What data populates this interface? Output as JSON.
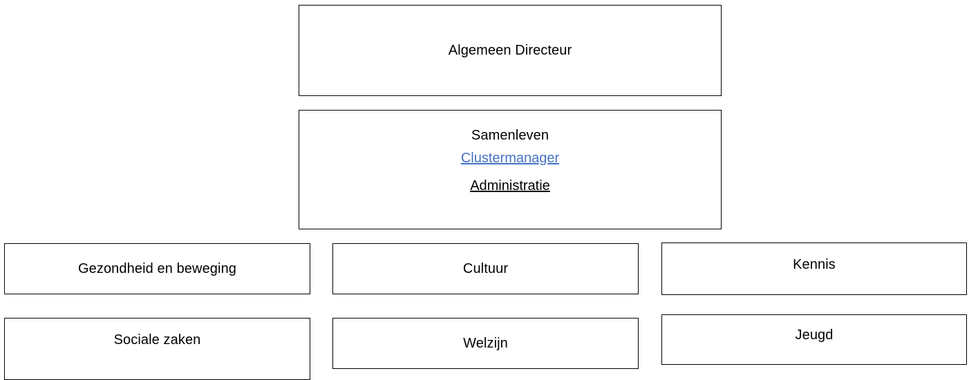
{
  "org_chart": {
    "director": {
      "label": "Algemeen Directeur"
    },
    "cluster": {
      "title": "Samenleven",
      "links": [
        {
          "label": "Clustermanager",
          "color": "#4472C4"
        },
        {
          "label": "Administratie",
          "color": "#000000"
        }
      ]
    },
    "departments": [
      {
        "label": "Gezondheid en beweging"
      },
      {
        "label": "Cultuur"
      },
      {
        "label": "Kennis"
      },
      {
        "label": "Sociale zaken"
      },
      {
        "label": "Welzijn"
      },
      {
        "label": "Jeugd"
      }
    ]
  },
  "colors": {
    "border": "#000000",
    "background": "#FFFFFF",
    "link_blue": "#4472C4",
    "text": "#000000"
  }
}
